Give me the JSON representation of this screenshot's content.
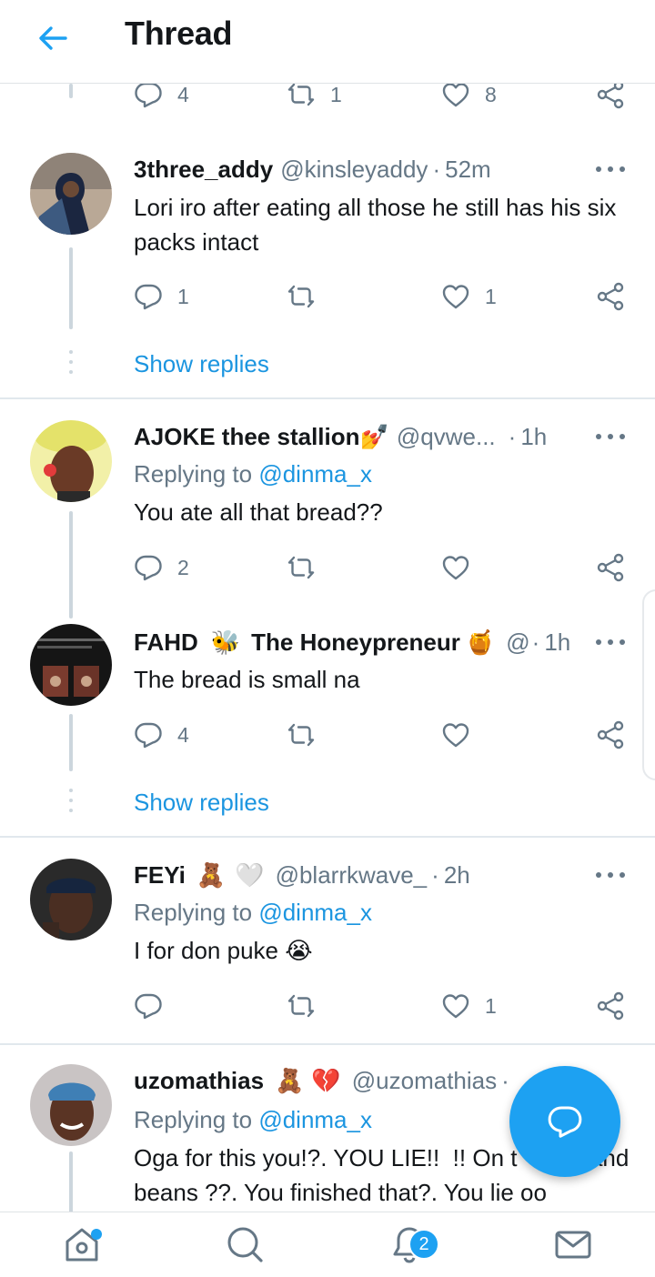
{
  "header": {
    "title": "Thread"
  },
  "top_partial": {
    "replies": "4",
    "retweets": "1",
    "likes": "8"
  },
  "tweets": [
    {
      "name": "3three_addy",
      "handle": "@kinsleyaddy",
      "sep": "·",
      "time": "52m",
      "text": "Lori iro after eating all those he still has his six packs intact",
      "replies": "1",
      "retweets": "",
      "likes": "1",
      "show_replies": "Show replies"
    },
    {
      "name": "AJOKE thee stallion",
      "name_emoji": "💅",
      "handle": "@qvwe...",
      "sep": "·",
      "time": "1h",
      "replying_label": "Replying to",
      "replying_mention": "@dinma_x",
      "text": "You ate all that bread??",
      "replies": "2",
      "retweets": "",
      "likes": ""
    },
    {
      "name": "FAHD",
      "name_emoji": "🐝",
      "name_rest": "The Honeypreneur",
      "name_emoji2": "🍯",
      "handle": "@",
      "sep": "·",
      "time": "1h",
      "text": "The bread is small na",
      "replies": "4",
      "retweets": "",
      "likes": "",
      "show_replies": "Show replies"
    },
    {
      "name": "FEYi",
      "name_emoji": "🧸",
      "name_emoji2": "🤍",
      "handle": "@blarrkwave_",
      "sep": "·",
      "time": "2h",
      "replying_label": "Replying to",
      "replying_mention": "@dinma_x",
      "text": "I for don puke 😭",
      "replies": "",
      "retweets": "",
      "likes": "1"
    },
    {
      "name": "uzomathias",
      "name_emoji": "🧸",
      "name_emoji2": "💔",
      "handle": "@uzomathias",
      "sep": "·",
      "replying_label": "Replying to",
      "replying_mention": "@dinma_x",
      "text": "Oga for this you!?. YOU LIE!!  !! On t      ad and beans ??. You finished that?. You lie oo"
    }
  ],
  "tabbar": {
    "notifications_badge": "2"
  },
  "icons": {
    "back": "arrow-left-icon",
    "reply": "reply-bubble-icon",
    "retweet": "retweet-icon",
    "like": "heart-icon",
    "share": "share-icon",
    "more": "more-dots-icon",
    "compose": "compose-reply-icon",
    "home": "home-icon",
    "search": "search-icon",
    "notifications": "bell-icon",
    "messages": "mail-icon"
  },
  "colors": {
    "accent": "#1da1f2",
    "link": "#1b95e0",
    "muted": "#657786",
    "line": "#ccd6dd"
  }
}
